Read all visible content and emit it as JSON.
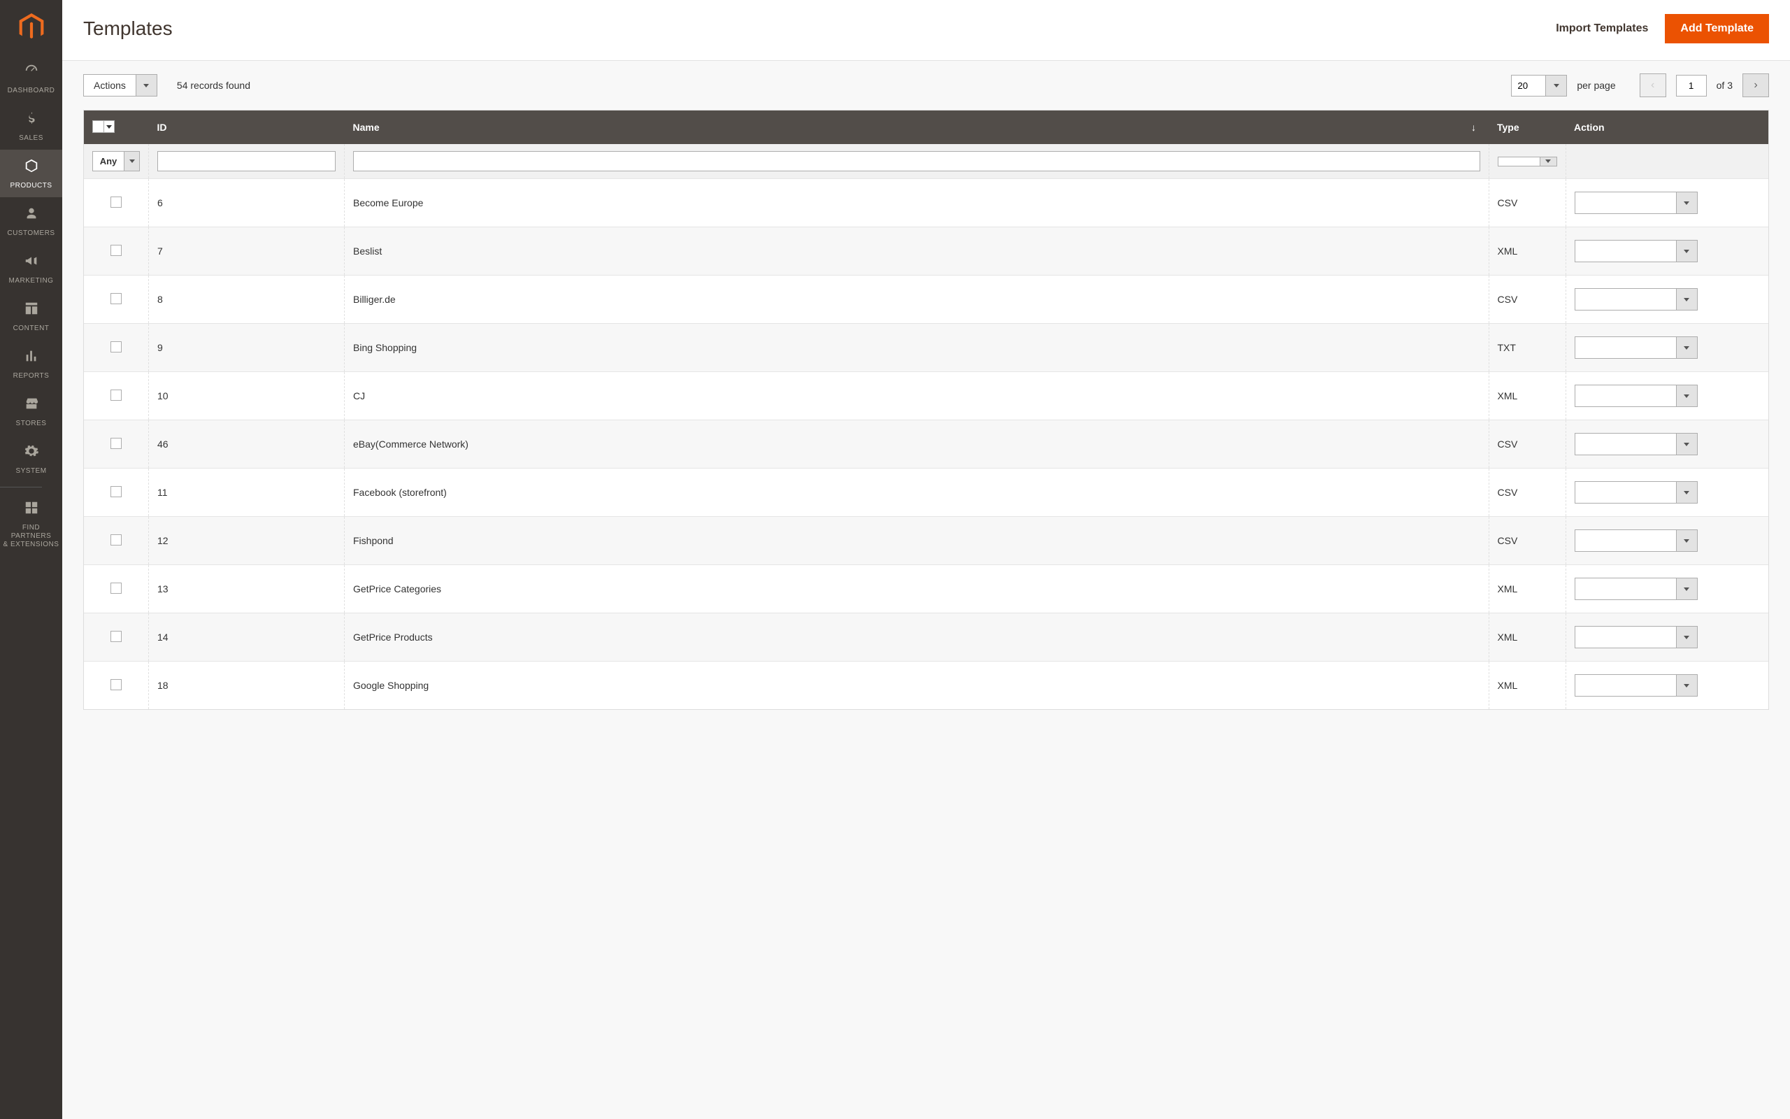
{
  "page": {
    "title": "Templates"
  },
  "header": {
    "import_label": "Import Templates",
    "add_button": "Add Template"
  },
  "sidebar": {
    "items": [
      {
        "label": "DASHBOARD",
        "icon": "dashboard"
      },
      {
        "label": "SALES",
        "icon": "dollar"
      },
      {
        "label": "PRODUCTS",
        "icon": "cube",
        "active": true
      },
      {
        "label": "CUSTOMERS",
        "icon": "person"
      },
      {
        "label": "MARKETING",
        "icon": "megaphone"
      },
      {
        "label": "CONTENT",
        "icon": "layout"
      },
      {
        "label": "REPORTS",
        "icon": "bars"
      },
      {
        "label": "STORES",
        "icon": "storefront"
      },
      {
        "label": "SYSTEM",
        "icon": "gear"
      },
      {
        "label": "FIND PARTNERS\n& EXTENSIONS",
        "icon": "blocks"
      }
    ]
  },
  "toolbar": {
    "actions_label": "Actions",
    "records_found": "54 records found",
    "page_size": "20",
    "per_page_label": "per page",
    "current_page": "1",
    "of_pages": "of 3"
  },
  "filters": {
    "any_label": "Any"
  },
  "table": {
    "columns": {
      "id": "ID",
      "name": "Name",
      "type": "Type",
      "action": "Action"
    },
    "rows": [
      {
        "id": "6",
        "name": "Become Europe",
        "type": "CSV"
      },
      {
        "id": "7",
        "name": "Beslist",
        "type": "XML"
      },
      {
        "id": "8",
        "name": "Billiger.de",
        "type": "CSV"
      },
      {
        "id": "9",
        "name": "Bing Shopping",
        "type": "TXT"
      },
      {
        "id": "10",
        "name": "CJ",
        "type": "XML"
      },
      {
        "id": "46",
        "name": "eBay(Commerce Network)",
        "type": "CSV"
      },
      {
        "id": "11",
        "name": "Facebook (storefront)",
        "type": "CSV"
      },
      {
        "id": "12",
        "name": "Fishpond",
        "type": "CSV"
      },
      {
        "id": "13",
        "name": "GetPrice Categories",
        "type": "XML"
      },
      {
        "id": "14",
        "name": "GetPrice Products",
        "type": "XML"
      },
      {
        "id": "18",
        "name": "Google Shopping",
        "type": "XML"
      }
    ]
  }
}
